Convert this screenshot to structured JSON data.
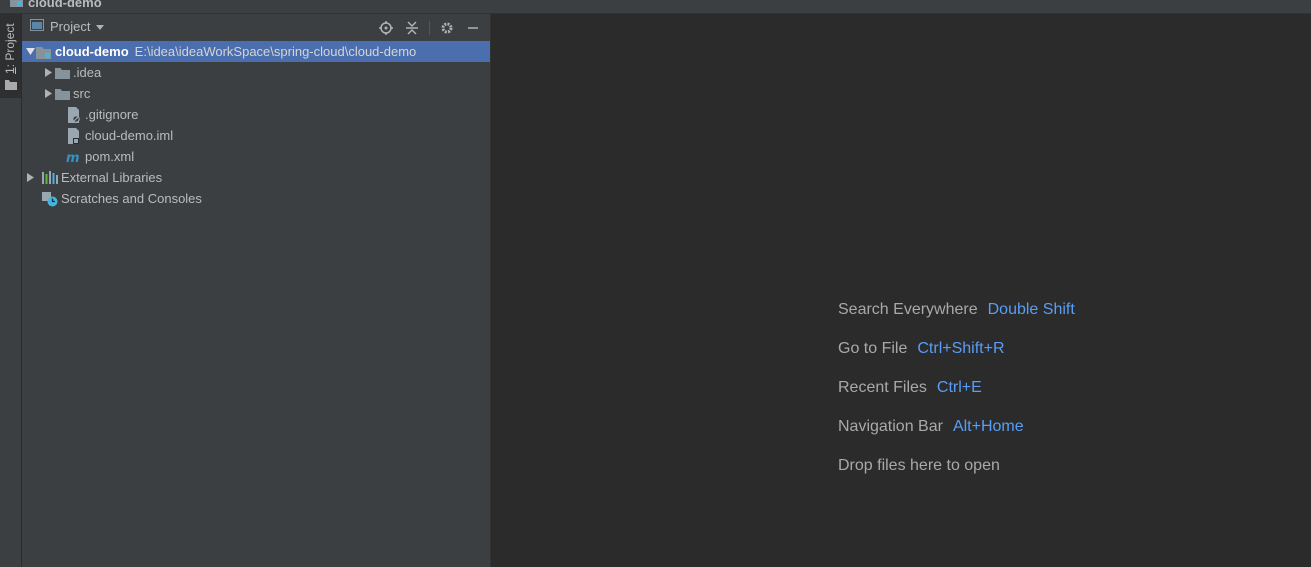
{
  "window": {
    "title": "cloud-demo"
  },
  "toolwindow": {
    "tab_number": "1",
    "tab_label": ": Project"
  },
  "panel": {
    "title": "Project",
    "tools": [
      "locate-icon",
      "collapse-all-icon",
      "gear-icon",
      "minimize-icon"
    ]
  },
  "tree": {
    "root": {
      "name": "cloud-demo",
      "path": "E:\\idea\\ideaWorkSpace\\spring-cloud\\cloud-demo"
    },
    "children": [
      {
        "name": ".idea",
        "icon": "folder-icon"
      },
      {
        "name": "src",
        "icon": "folder-icon"
      },
      {
        "name": ".gitignore",
        "icon": "ignore-file-icon"
      },
      {
        "name": "cloud-demo.iml",
        "icon": "iml-file-icon"
      },
      {
        "name": "pom.xml",
        "icon": "maven-icon"
      }
    ],
    "external": {
      "name": "External Libraries",
      "icon": "libraries-icon"
    },
    "scratches": {
      "name": "Scratches and Consoles",
      "icon": "scratches-icon"
    }
  },
  "editor": {
    "hints": [
      {
        "label": "Search Everywhere",
        "key": "Double Shift"
      },
      {
        "label": "Go to File",
        "key": "Ctrl+Shift+R"
      },
      {
        "label": "Recent Files",
        "key": "Ctrl+E"
      },
      {
        "label": "Navigation Bar",
        "key": "Alt+Home"
      },
      {
        "label": "Drop files here to open",
        "key": ""
      }
    ]
  },
  "colors": {
    "selection": "#4b6eaf",
    "shortcut": "#589df6",
    "panel": "#3c3f41",
    "editor": "#2b2b2b"
  }
}
